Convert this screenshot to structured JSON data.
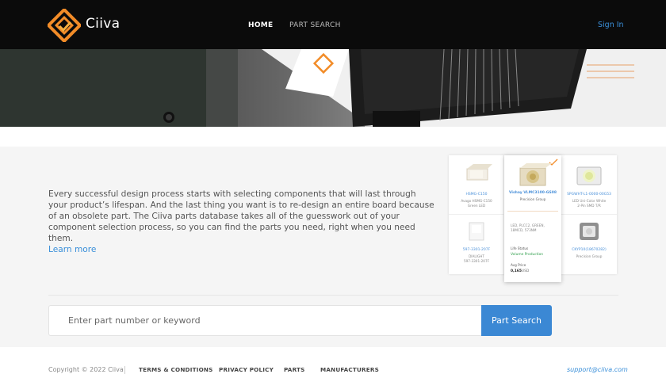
{
  "header": {
    "brand": "Ciiva",
    "nav": {
      "home": "HOME",
      "part_search": "PART SEARCH"
    },
    "sign_in": "Sign In"
  },
  "intro": {
    "text": "Every successful design process starts with selecting components that will last through your product’s lifespan. And the last thing you want is to re-design an entire board because of an obsolete part. The Ciiva parts database takes all of the guesswork out of your component selection process, so you can find the parts you need, right when you need them.",
    "learn_more": "Learn more"
  },
  "products": {
    "tile1": {
      "title": "HSMG-C150",
      "sub1": "Avago HSMG-C150",
      "sub2": "Green LED"
    },
    "featured": {
      "title": "Vishay VLMC3100-GS08",
      "sub": "Precision Group",
      "desc": "LED, PLCC2, GREEN, 18MCD, 573NM",
      "status_label": "Life Status",
      "status_value": "Volume Production",
      "price_label": "Avg Price",
      "price_value": "0,165",
      "price_unit": "USD"
    },
    "tile3": {
      "title": "SPGWHT-L1-0000-00G53",
      "sub1": "LED Uni-Color White",
      "sub2": "2-Pin SMD T/R"
    },
    "tile4": {
      "title": "597-3301-207F",
      "sub1": "DIALIGHT",
      "sub2": "597-3301-207F"
    },
    "tile6": {
      "title": "CKYP10(18670282)",
      "sub1": "Precision Group"
    }
  },
  "search": {
    "placeholder": "Enter part number or keyword",
    "button": "Part Search"
  },
  "footer": {
    "copyright": "Copyright © 2022 Ciiva",
    "links": [
      "TERMS & CONDITIONS",
      "PRIVACY POLICY",
      "PARTS",
      "MANUFACTURERS"
    ],
    "support": "support@ciiva.com"
  },
  "colors": {
    "accent": "#3b88d4",
    "brand_orange": "#f28c28",
    "header_bg": "#0b0b0b"
  }
}
